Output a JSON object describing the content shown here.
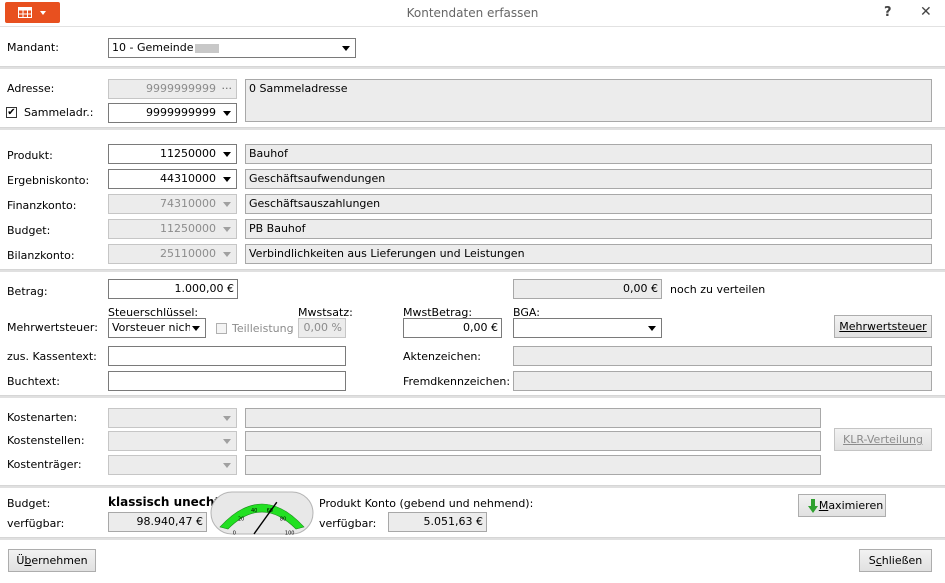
{
  "window": {
    "title": "Kontendaten erfassen",
    "help_label": "?",
    "close_label": "✕",
    "accent": "#e8501f"
  },
  "mandant": {
    "label": "Mandant:",
    "value": "10 - Gemeinde"
  },
  "address": {
    "label": "Adresse:",
    "number": "9999999999",
    "dots": "···",
    "sammel_label": "Sammeladr.:",
    "sammel_checked": "✔",
    "sammel_number": "9999999999",
    "text": "0 Sammeladresse"
  },
  "accounts": {
    "produkt": {
      "label": "Produkt:",
      "number": "11250000",
      "text": "Bauhof"
    },
    "ergebnis": {
      "label": "Ergebniskonto:",
      "number": "44310000",
      "text": "Geschäftsaufwendungen"
    },
    "finanz": {
      "label": "Finanzkonto:",
      "number": "74310000",
      "text": "Geschäftsauszahlungen"
    },
    "budget": {
      "label": "Budget:",
      "number": "11250000",
      "text": "PB Bauhof"
    },
    "bilanz": {
      "label": "Bilanzkonto:",
      "number": "25110000",
      "text": "Verbindlichkeiten aus Lieferungen und Leistungen"
    }
  },
  "amount": {
    "label": "Betrag:",
    "value": "1.000,00 €",
    "remaining_value": "0,00 €",
    "remaining_label": "noch zu verteilen"
  },
  "tax": {
    "label": "Mehrwertsteuer:",
    "key_header": "Steuerschlüssel:",
    "key_value": "Vorsteuer nicht r",
    "partial_label": "Teilleistung",
    "rate_header": "Mwstsatz:",
    "rate_value": "0,00 %",
    "amount_header": "MwstBetrag:",
    "amount_value": "0,00 €",
    "bga_header": "BGA:",
    "bga_value": "",
    "button_label": "Mehrwertsteuer"
  },
  "texts": {
    "kassentext_label": "zus. Kassentext:",
    "kassentext_value": "",
    "buchtext_label": "Buchtext:",
    "buchtext_value": "",
    "aktenzeichen_label": "Aktenzeichen:",
    "aktenzeichen_value": "",
    "fremd_label": "Fremdkennzeichen:",
    "fremd_value": ""
  },
  "klr": {
    "kostenarten_label": "Kostenarten:",
    "kostenstellen_label": "Kostenstellen:",
    "kostentraeger_label": "Kostenträger:",
    "button_label": "KLR-Verteilung"
  },
  "budget_info": {
    "label": "Budget:",
    "mode": "klassisch unecht",
    "available_label": "verfügbar:",
    "available_value": "98.940,47 €",
    "gauge_ticks": [
      "0",
      "20",
      "40",
      "60",
      "80",
      "100"
    ],
    "gauge_pointer_percent": 65,
    "produkt_label": "Produkt Konto (gebend und nehmend):",
    "produkt_available_label": "verfügbar:",
    "produkt_available_value": "5.051,63 €",
    "maximize_label": "Maximieren"
  },
  "footer": {
    "apply_label": "Übernehmen",
    "close_label": "Schließen"
  }
}
